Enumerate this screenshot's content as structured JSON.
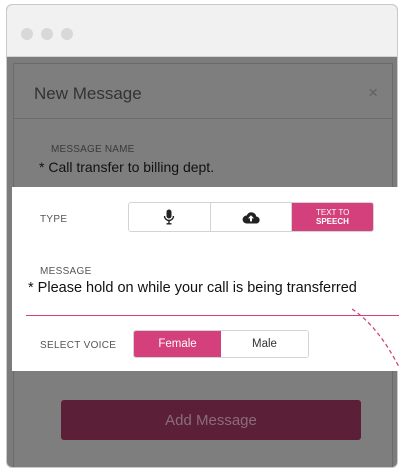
{
  "modal": {
    "title": "New Message",
    "close_glyph": "×"
  },
  "message_name": {
    "label": "MESSAGE NAME",
    "value": "* Call transfer to billing dept."
  },
  "type": {
    "label": "TYPE",
    "options": [
      {
        "icon": "microphone-icon",
        "active": false
      },
      {
        "icon": "cloud-upload-icon",
        "active": false
      },
      {
        "line1": "TEXT TO",
        "line2": "SPEECH",
        "active": true
      }
    ]
  },
  "message": {
    "label": "MESSAGE",
    "value": "* Please hold on while your call is being transferred"
  },
  "voice": {
    "label": "SELECT VOICE",
    "options": [
      {
        "label": "Female",
        "active": true
      },
      {
        "label": "Male",
        "active": false
      }
    ]
  },
  "actions": {
    "add_label": "Add Message"
  },
  "colors": {
    "accent": "#d4407b",
    "overlay": "#7c7c7c",
    "button_dimmed": "#5b1f37"
  }
}
